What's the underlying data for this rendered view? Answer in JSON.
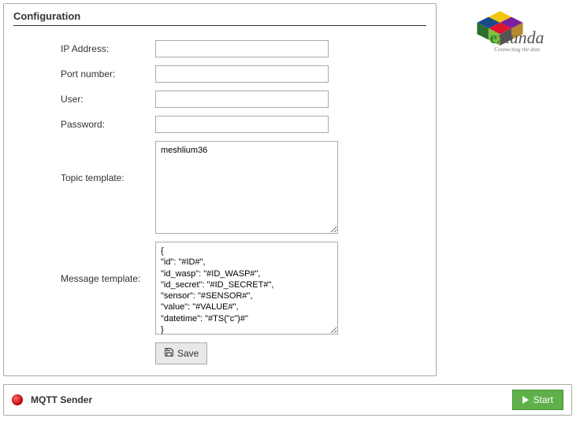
{
  "config": {
    "title": "Configuration",
    "labels": {
      "ip": "IP Address:",
      "port": "Port number:",
      "user": "User:",
      "password": "Password:",
      "topic": "Topic template:",
      "message": "Message template:"
    },
    "values": {
      "ip": "",
      "port": "",
      "user": "",
      "password": "",
      "topic": "meshlium36",
      "message": "{\n\"id\": \"#ID#\",\n\"id_wasp\": \"#ID_WASP#\",\n\"id_secret\": \"#ID_SECRET#\",\n\"sensor\": \"#SENSOR#\",\n\"value\": \"#VALUE#\",\n\"datetime\": \"#TS(\"c\")#\"\n}"
    },
    "save_label": "Save"
  },
  "logo": {
    "name": "extunda",
    "tagline": "Connecting the dots"
  },
  "footer": {
    "title": "MQTT Sender",
    "start_label": "Start",
    "status": "stopped"
  }
}
